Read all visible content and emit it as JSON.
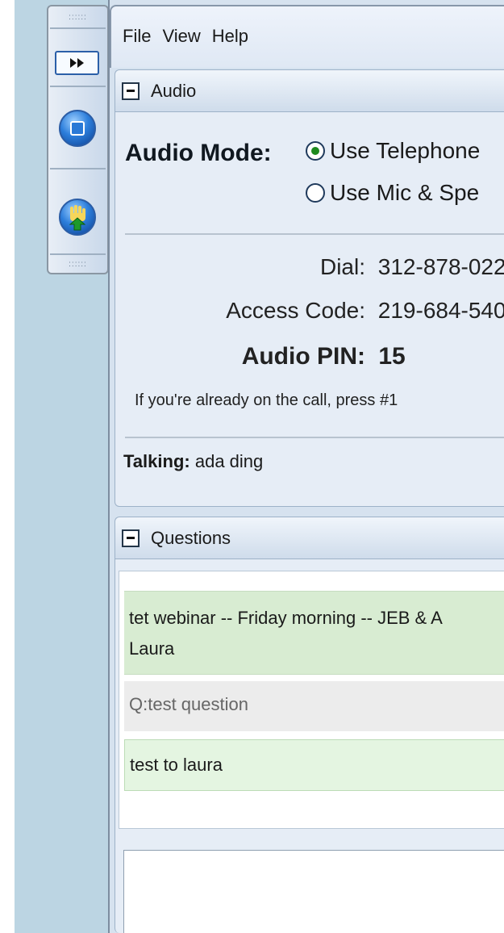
{
  "menu": {
    "file": "File",
    "view": "View",
    "help": "Help"
  },
  "toolbar": {
    "grip_top": "::::::",
    "grip_bottom": "::::::"
  },
  "audio": {
    "header": "Audio",
    "mode_label": "Audio Mode:",
    "options": [
      {
        "label": "Use Telephone",
        "selected": true
      },
      {
        "label": "Use Mic & Spe",
        "selected": false
      }
    ],
    "dial_label": "Dial:",
    "dial_value": "312-878-022",
    "access_label": "Access Code:",
    "access_value": "219-684-540",
    "pin_label": "Audio PIN:",
    "pin_value": "15",
    "note": "If you're already on the call, press #1",
    "talking_label": "Talking:",
    "talking_value": "ada ding"
  },
  "questions": {
    "header": "Questions",
    "items": [
      {
        "line1": "tet webinar -- Friday morning -- JEB & A",
        "line2": "Laura"
      },
      {
        "text": "Q:test question"
      },
      {
        "text": "test to laura"
      }
    ],
    "reply_value": ""
  },
  "colors": {
    "accent": "#2b5fa8",
    "answer_bg": "#e4f5e1",
    "title_bg": "#d8ecd2",
    "selected_radio": "#1e8a1e"
  }
}
